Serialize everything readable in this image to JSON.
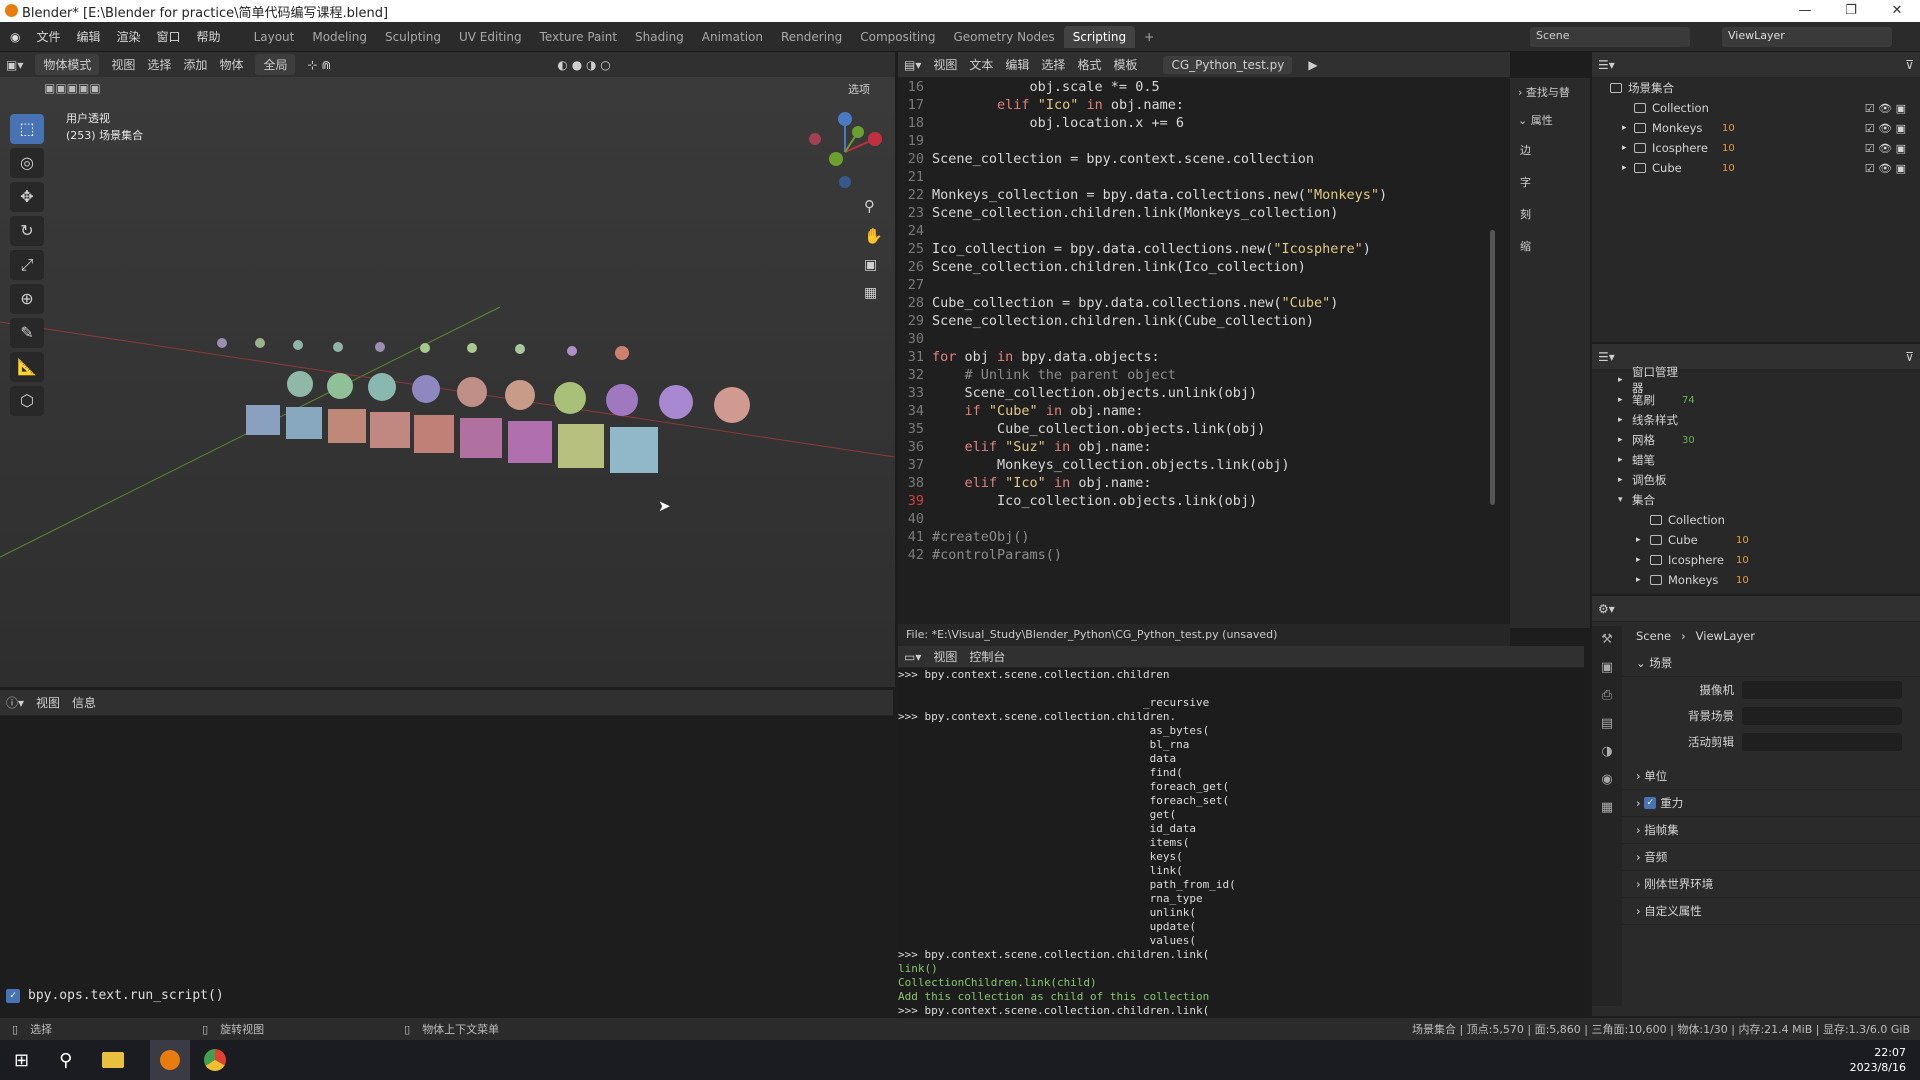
{
  "titlebar": {
    "title": "Blender* [E:\\Blender for practice\\简单代码编写课程.blend]"
  },
  "menu": [
    "文件",
    "编辑",
    "渲染",
    "窗口",
    "帮助"
  ],
  "workspaces": [
    "Layout",
    "Modeling",
    "Sculpting",
    "UV Editing",
    "Texture Paint",
    "Shading",
    "Animation",
    "Rendering",
    "Compositing",
    "Geometry Nodes",
    "Scripting"
  ],
  "scene": {
    "scene": "Scene",
    "viewlayer": "ViewLayer"
  },
  "viewport": {
    "mode": "物体模式",
    "menus": [
      "视图",
      "选择",
      "添加",
      "物体"
    ],
    "orient": "全局",
    "options": "选项",
    "persp": "用户透视",
    "collection": "(253) 场景集合"
  },
  "text_editor": {
    "menus": [
      "视图",
      "文本",
      "编辑",
      "选择",
      "格式",
      "模板"
    ],
    "file": "CG_Python_test.py",
    "filepath": "File: *E:\\Visual_Study\\Blender_Python\\CG_Python_test.py (unsaved)"
  },
  "side_tabs": {
    "find": "查找与替",
    "props": "属性",
    "f1": "边",
    "f2": "字",
    "f3": "刻",
    "f4": "缩"
  },
  "code": [
    {
      "n": "16",
      "t": "            obj.scale *= 0.5"
    },
    {
      "n": "17",
      "t": "        elif \"Ico\" in obj.name:"
    },
    {
      "n": "18",
      "t": "            obj.location.x += 6"
    },
    {
      "n": "19",
      "t": ""
    },
    {
      "n": "20",
      "t": "Scene_collection = bpy.context.scene.collection"
    },
    {
      "n": "21",
      "t": ""
    },
    {
      "n": "22",
      "t": "Monkeys_collection = bpy.data.collections.new(\"Monkeys\")"
    },
    {
      "n": "23",
      "t": "Scene_collection.children.link(Monkeys_collection)"
    },
    {
      "n": "24",
      "t": ""
    },
    {
      "n": "25",
      "t": "Ico_collection = bpy.data.collections.new(\"Icosphere\")"
    },
    {
      "n": "26",
      "t": "Scene_collection.children.link(Ico_collection)"
    },
    {
      "n": "27",
      "t": ""
    },
    {
      "n": "28",
      "t": "Cube_collection = bpy.data.collections.new(\"Cube\")"
    },
    {
      "n": "29",
      "t": "Scene_collection.children.link(Cube_collection)"
    },
    {
      "n": "30",
      "t": ""
    },
    {
      "n": "31",
      "t": "for obj in bpy.data.objects:"
    },
    {
      "n": "32",
      "t": "    # Unlink the parent object"
    },
    {
      "n": "33",
      "t": "    Scene_collection.objects.unlink(obj)"
    },
    {
      "n": "34",
      "t": "    if \"Cube\" in obj.name:"
    },
    {
      "n": "35",
      "t": "        Cube_collection.objects.link(obj)"
    },
    {
      "n": "36",
      "t": "    elif \"Suz\" in obj.name:"
    },
    {
      "n": "37",
      "t": "        Monkeys_collection.objects.link(obj)"
    },
    {
      "n": "38",
      "t": "    elif \"Ico\" in obj.name:"
    },
    {
      "n": "39",
      "t": "        Ico_collection.objects.link(obj)"
    },
    {
      "n": "40",
      "t": ""
    },
    {
      "n": "41",
      "t": "#createObj()"
    },
    {
      "n": "42",
      "t": "#controlParams()"
    }
  ],
  "console": {
    "menus": [
      "视图",
      "控制台"
    ],
    "lines": [
      ">>> bpy.context.scene.collection.children",
      "",
      "                                     _recursive",
      ">>> bpy.context.scene.collection.children.",
      "                                      as_bytes(",
      "                                      bl_rna",
      "                                      data",
      "                                      find(",
      "                                      foreach_get(",
      "                                      foreach_set(",
      "                                      get(",
      "                                      id_data",
      "                                      items(",
      "                                      keys(",
      "                                      link(",
      "                                      path_from_id(",
      "                                      rna_type",
      "                                      unlink(",
      "                                      update(",
      "                                      values(",
      ">>> bpy.context.scene.collection.children.link(",
      "link()",
      "CollectionChildren.link(child)",
      "Add this collection as child of this collection",
      ">>> bpy.context.scene.collection.children.link("
    ]
  },
  "info": {
    "menus": [
      "视图",
      "信息"
    ],
    "log": "bpy.ops.text.run_script()"
  },
  "outliner": {
    "root": "场景集合",
    "items": [
      {
        "name": "Collection"
      },
      {
        "name": "Monkeys",
        "c": "10"
      },
      {
        "name": "Icosphere",
        "c": "10"
      },
      {
        "name": "Cube",
        "c": "10"
      }
    ]
  },
  "blendfile": {
    "items": [
      {
        "name": "窗口管理器"
      },
      {
        "name": "笔刷",
        "c": "74"
      },
      {
        "name": "线条样式"
      },
      {
        "name": "网格",
        "c": "30"
      },
      {
        "name": "蜡笔"
      },
      {
        "name": "调色板"
      },
      {
        "name": "集合"
      }
    ],
    "children": [
      {
        "name": "Collection"
      },
      {
        "name": "Cube",
        "c": "10"
      },
      {
        "name": "Icosphere",
        "c": "10"
      },
      {
        "name": "Monkeys",
        "c": "10"
      }
    ]
  },
  "properties": {
    "scene": "Scene",
    "viewlayer": "ViewLayer",
    "section": "场景",
    "camera": "摄像机",
    "bg": "背景场景",
    "clip": "活动剪辑",
    "panels": [
      "单位",
      "重力",
      "指帧集",
      "音频",
      "刚体世界环境",
      "自定义属性"
    ]
  },
  "status": {
    "select": "选择",
    "rotate": "旋转视图",
    "ctx": "物体上下文菜单",
    "stats": "场景集合 | 顶点:5,570 | 面:5,860 | 三角面:10,600 | 物体:1/30 | 内存:21.4 MiB | 显存:1.3/6.0 GiB"
  },
  "clock": {
    "time": "22:07",
    "date": "2023/8/16"
  }
}
